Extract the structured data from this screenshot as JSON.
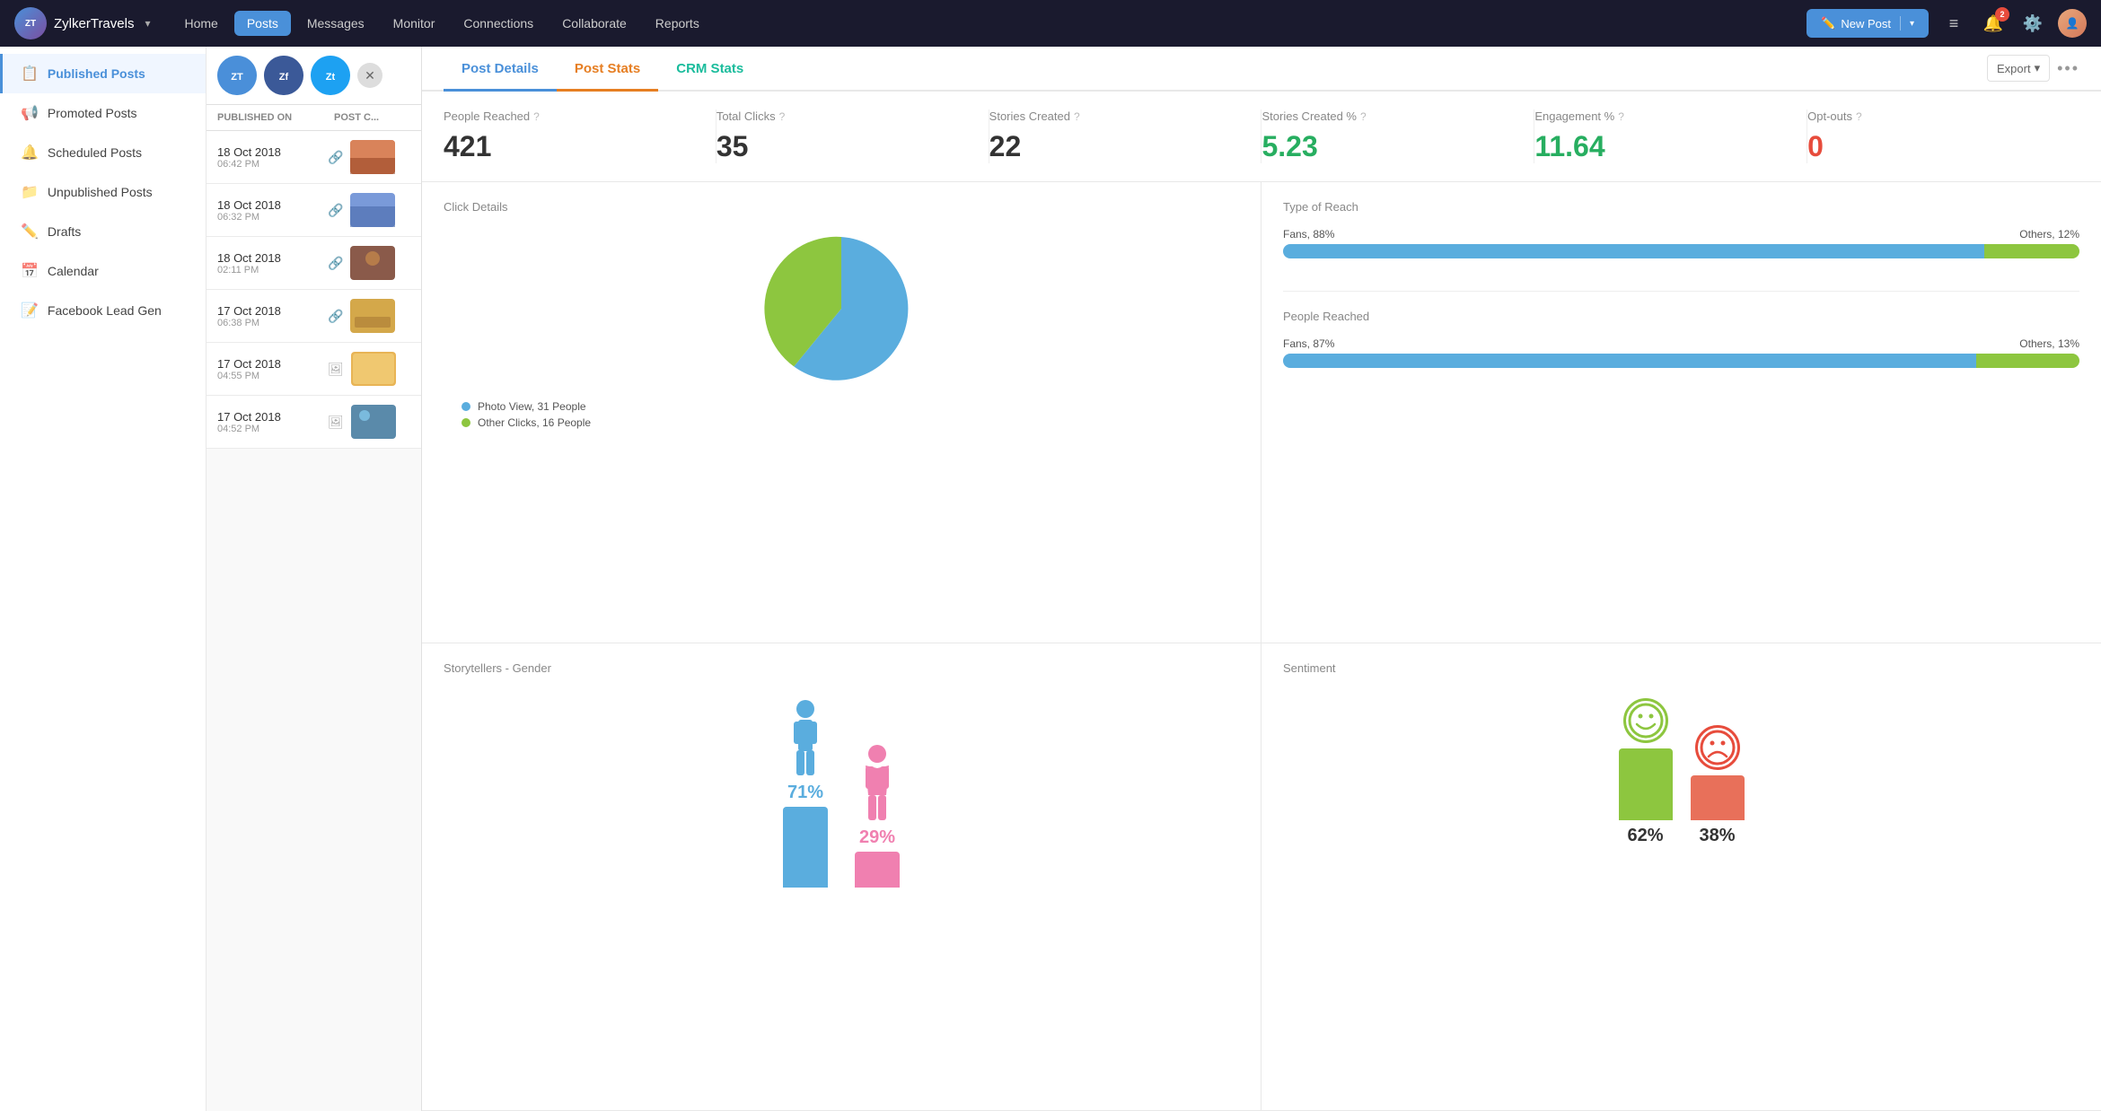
{
  "brand": {
    "logo_text": "ZT",
    "name": "ZylkerTravels",
    "chevron": "▾"
  },
  "topnav": {
    "items": [
      {
        "label": "Home",
        "active": false
      },
      {
        "label": "Posts",
        "active": true
      },
      {
        "label": "Messages",
        "active": false
      },
      {
        "label": "Monitor",
        "active": false
      },
      {
        "label": "Connections",
        "active": false
      },
      {
        "label": "Collaborate",
        "active": false
      },
      {
        "label": "Reports",
        "active": false
      }
    ],
    "new_post_label": "New Post",
    "notification_count": "2"
  },
  "sidebar": {
    "items": [
      {
        "label": "Published Posts",
        "icon": "📋",
        "active": true
      },
      {
        "label": "Promoted Posts",
        "icon": "📢",
        "active": false
      },
      {
        "label": "Scheduled Posts",
        "icon": "🔔",
        "active": false
      },
      {
        "label": "Unpublished Posts",
        "icon": "📁",
        "active": false
      },
      {
        "label": "Drafts",
        "icon": "✏️",
        "active": false
      },
      {
        "label": "Calendar",
        "icon": "📅",
        "active": false
      },
      {
        "label": "Facebook Lead Gen",
        "icon": "📝",
        "active": false
      }
    ]
  },
  "posts_columns": {
    "col1": "PUBLISHED ON",
    "col2": "POST C..."
  },
  "posts": [
    {
      "date": "18 Oct 2018",
      "time": "06:42 PM",
      "has_link": true,
      "thumb_color": "#c97a5a"
    },
    {
      "date": "18 Oct 2018",
      "time": "06:32 PM",
      "has_link": true,
      "thumb_color": "#5a7ac9"
    },
    {
      "date": "18 Oct 2018",
      "time": "02:11 PM",
      "has_link": true,
      "thumb_color": "#8a4a3a"
    },
    {
      "date": "17 Oct 2018",
      "time": "06:38 PM",
      "has_link": true,
      "thumb_color": "#c9a55a"
    },
    {
      "date": "17 Oct 2018",
      "time": "04:55 PM",
      "has_link": false,
      "thumb_color": "#e8b455"
    },
    {
      "date": "17 Oct 2018",
      "time": "04:52 PM",
      "has_link": false,
      "thumb_color": "#4a7a9a"
    }
  ],
  "detail": {
    "tabs": [
      {
        "label": "Post Details",
        "style": "active-blue"
      },
      {
        "label": "Post Stats",
        "style": "active-orange"
      },
      {
        "label": "CRM Stats",
        "style": "active-teal"
      }
    ],
    "export_label": "Export",
    "more_icon": "•••"
  },
  "stats": [
    {
      "label": "People Reached",
      "value": "421",
      "color": "normal"
    },
    {
      "label": "Total Clicks",
      "value": "35",
      "color": "normal"
    },
    {
      "label": "Stories Created",
      "value": "22",
      "color": "normal"
    },
    {
      "label": "Stories Created %",
      "value": "5.23",
      "color": "green"
    },
    {
      "label": "Engagement %",
      "value": "11.64",
      "color": "green"
    },
    {
      "label": "Opt-outs",
      "value": "0",
      "color": "red"
    }
  ],
  "click_details": {
    "title": "Click Details",
    "legend": [
      {
        "label": "Photo View, 31 People",
        "color": "#5aadde"
      },
      {
        "label": "Other Clicks, 16 People",
        "color": "#8dc63f"
      }
    ],
    "pie": {
      "photo_view_pct": 66,
      "other_clicks_pct": 34
    }
  },
  "type_of_reach": {
    "title": "Type of Reach",
    "fans_label": "Fans, 88%",
    "others_label": "Others, 12%",
    "fans_pct": 88,
    "others_pct": 12
  },
  "people_reached": {
    "title": "People Reached",
    "fans_label": "Fans, 87%",
    "others_label": "Others, 13%",
    "fans_pct": 87,
    "others_pct": 13
  },
  "storytellers_gender": {
    "title": "Storytellers - Gender",
    "male_pct": "71%",
    "female_pct": "29%",
    "male_bar_height": 90,
    "female_bar_height": 40
  },
  "sentiment": {
    "title": "Sentiment",
    "happy_pct": "62%",
    "sad_pct": "38%",
    "happy_bar_height": 80,
    "sad_bar_height": 50
  }
}
